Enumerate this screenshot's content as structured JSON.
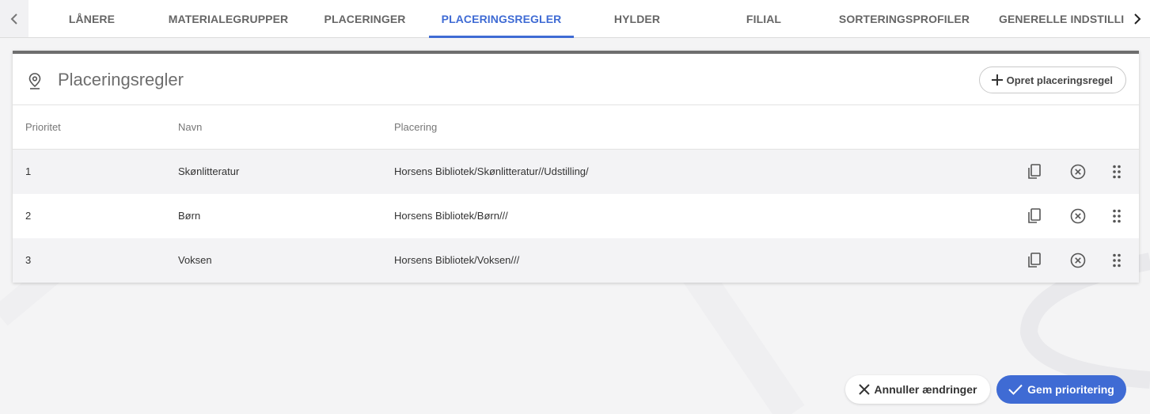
{
  "tabs": [
    {
      "label": "LÅNERE"
    },
    {
      "label": "MATERIALEGRUPPER"
    },
    {
      "label": "PLACERINGER"
    },
    {
      "label": "PLACERINGSREGLER",
      "active": true
    },
    {
      "label": "HYLDER"
    },
    {
      "label": "FILIAL"
    },
    {
      "label": "SORTERINGSPROFILER"
    },
    {
      "label": "GENERELLE INDSTILLINGER"
    }
  ],
  "card": {
    "icon": "location-pin-icon",
    "title": "Placeringsregler",
    "create_button": "Opret placeringsregel"
  },
  "table": {
    "headers": {
      "priority": "Prioritet",
      "name": "Navn",
      "placement": "Placering"
    },
    "rows": [
      {
        "priority": "1",
        "name": "Skønlitteratur",
        "placement": "Horsens Bibliotek/Skønlitteratur//Udstilling/"
      },
      {
        "priority": "2",
        "name": "Børn",
        "placement": "Horsens Bibliotek/Børn///"
      },
      {
        "priority": "3",
        "name": "Voksen",
        "placement": "Horsens Bibliotek/Voksen///"
      }
    ],
    "row_actions": [
      "copy-icon",
      "remove-circle-icon",
      "drag-handle-icon"
    ]
  },
  "footer": {
    "cancel_label": "Annuller ændringer",
    "save_label": "Gem prioritering"
  },
  "colors": {
    "accent": "#3f6bd4",
    "card_border": "#6e6e6e"
  }
}
